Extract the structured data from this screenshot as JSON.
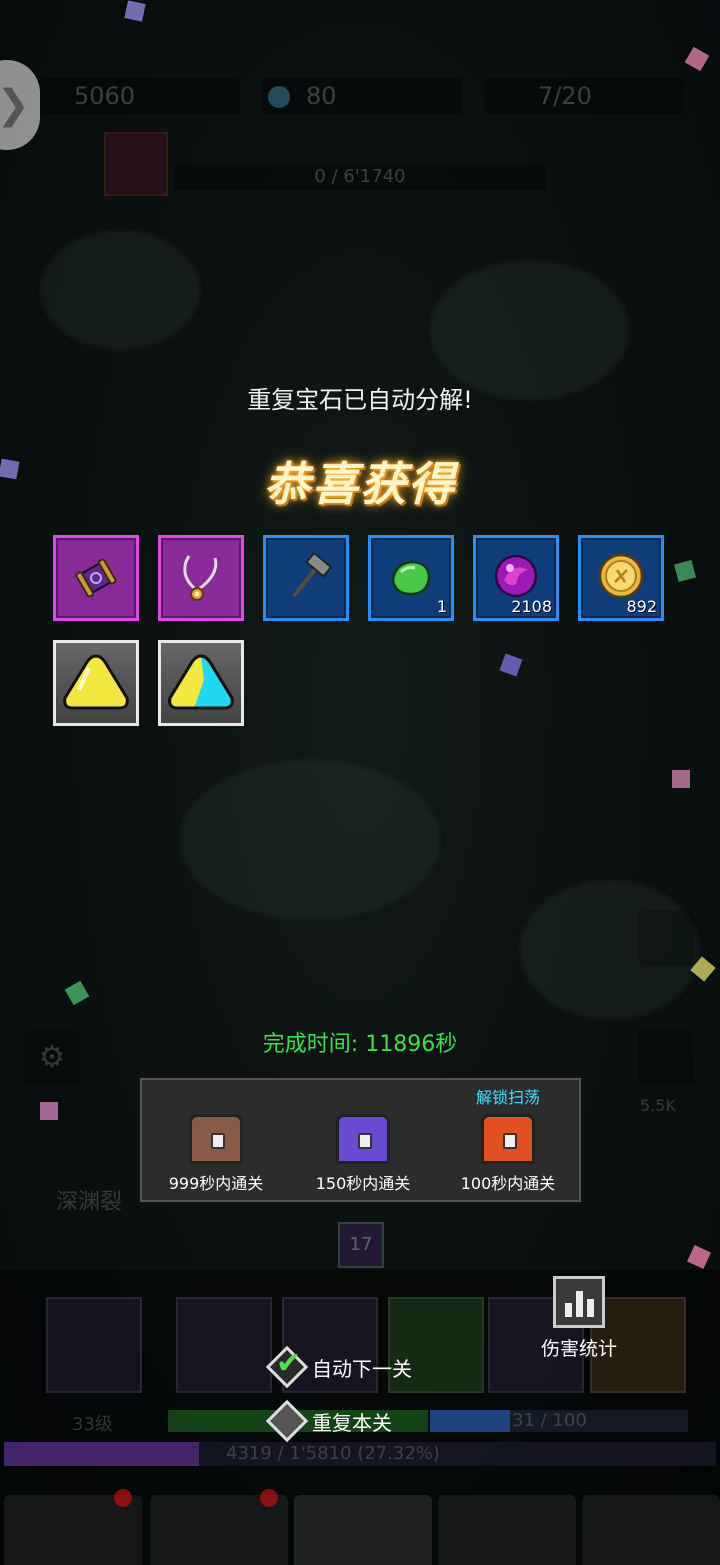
{
  "hud": {
    "gold": "5060",
    "gems": "80",
    "stamina": "7/20",
    "boss_hp": "0 / 6'1740"
  },
  "popup": {
    "notice": "重复宝石已自动分解!",
    "title": "恭喜获得",
    "rewards": [
      {
        "icon": "purple-scroll-icon",
        "count": ""
      },
      {
        "icon": "necklace-icon",
        "count": ""
      },
      {
        "icon": "hammer-icon",
        "count": ""
      },
      {
        "icon": "green-gem-icon",
        "count": "1"
      },
      {
        "icon": "purple-orb-icon",
        "count": "2108"
      },
      {
        "icon": "gold-coin-icon",
        "count": "892"
      },
      {
        "icon": "yellow-crystal-icon",
        "count": ""
      },
      {
        "icon": "cyan-crystal-icon",
        "count": ""
      }
    ],
    "clear_time": "完成时间: 11896秒",
    "chests": [
      {
        "label": "999秒内通关",
        "color": "#8a5a48",
        "tag": ""
      },
      {
        "label": "150秒内通关",
        "color": "#6a4ad0",
        "tag": ""
      },
      {
        "label": "100秒内通关",
        "color": "#e05020",
        "tag": "解锁扫荡"
      }
    ]
  },
  "controls": {
    "auto_next": "自动下一关",
    "repeat_stage": "重复本关",
    "damage_stats": "伤害统计"
  },
  "background_text": {
    "stage_name": "深渊裂",
    "wave": "17",
    "exp": "4319 / 1'5810 (27.32%)",
    "hero_level": "33级",
    "progress": "31 / 100",
    "right_stat": "5.5K"
  },
  "colors": {
    "accent_green": "#3ee04a",
    "title_glow": "#ffb23a",
    "unlock_cyan": "#3fe3ff"
  }
}
